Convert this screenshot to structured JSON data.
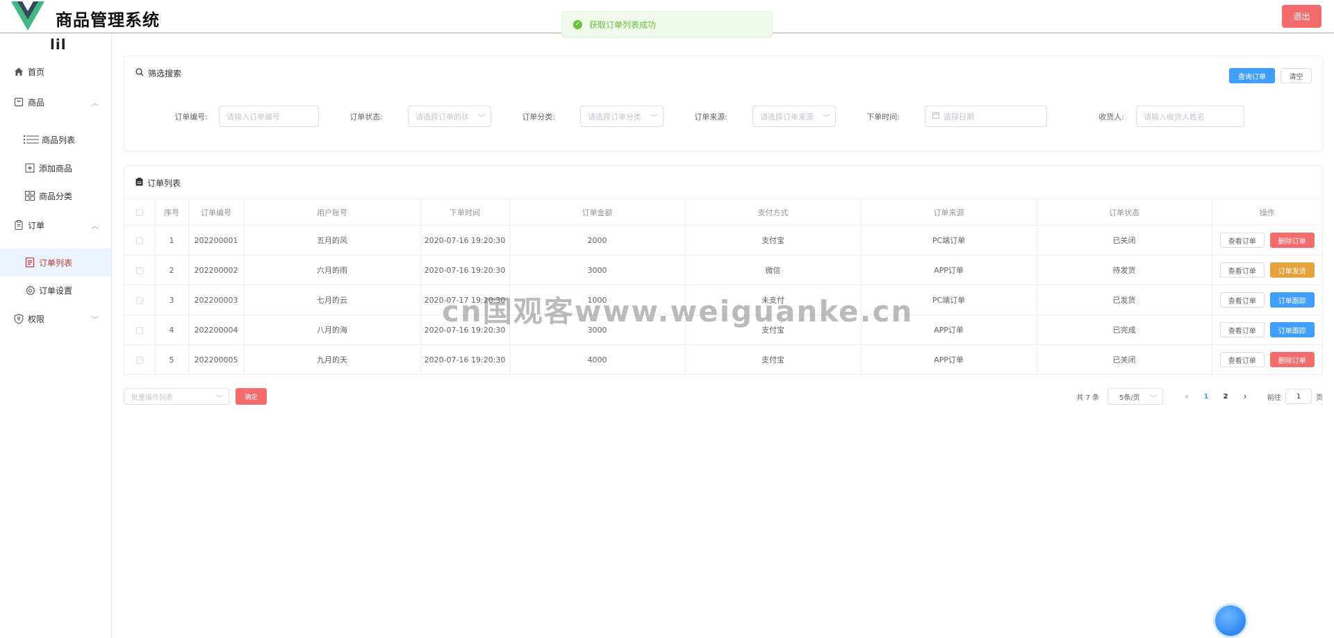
{
  "header": {
    "title": "商品管理系统",
    "logout_label": "退出"
  },
  "toast": {
    "message": "获取订单列表成功"
  },
  "sidebar": {
    "collapse_label": "lil",
    "items": [
      {
        "label": "首页",
        "icon": "home-icon"
      },
      {
        "label": "商品",
        "icon": "goods-icon",
        "expanded": true
      },
      {
        "label": "商品列表",
        "icon": "list-icon"
      },
      {
        "label": "添加商品",
        "icon": "add-box-icon"
      },
      {
        "label": "商品分类",
        "icon": "grid-icon"
      },
      {
        "label": "订单",
        "icon": "clipboard-icon",
        "expanded": true
      },
      {
        "label": "订单列表",
        "icon": "document-icon",
        "active": true
      },
      {
        "label": "订单设置",
        "icon": "gear-icon"
      },
      {
        "label": "权限",
        "icon": "shield-icon",
        "expanded": false
      }
    ]
  },
  "filter": {
    "title": "筛选搜索",
    "query_label": "查询订单",
    "clear_label": "清空",
    "fields": [
      {
        "label": "订单编号:",
        "placeholder": "请输入订单编号"
      },
      {
        "label": "订单状态:",
        "placeholder": "请选择订单的状态"
      },
      {
        "label": "订单分类:",
        "placeholder": "请选择订单分类"
      },
      {
        "label": "订单来源:",
        "placeholder": "请选择订单来源"
      },
      {
        "label": "下单时间:",
        "placeholder": "选择日期"
      },
      {
        "label": "收货人:",
        "placeholder": "请输入收货人姓名"
      }
    ]
  },
  "orders": {
    "title": "订单列表",
    "columns": [
      "序号",
      "订单编号",
      "用户账号",
      "下单时间",
      "订单金额",
      "支付方式",
      "订单来源",
      "订单状态",
      "操作"
    ],
    "rows": [
      {
        "index": "1",
        "id": "202200001",
        "user": "五月的风",
        "time": "2020-07-16 19:20:30",
        "amount": "2000",
        "pay": "支付宝",
        "source": "PC端订单",
        "status": "已关闭",
        "view": "查看订单",
        "action": "删除订单"
      },
      {
        "index": "2",
        "id": "202200002",
        "user": "六月的雨",
        "time": "2020-07-16 19:20:30",
        "amount": "3000",
        "pay": "微信",
        "source": "APP订单",
        "status": "待发货",
        "view": "查看订单",
        "action": "订单发货"
      },
      {
        "index": "3",
        "id": "202200003",
        "user": "七月的云",
        "time": "2020-07-17 19:20:30",
        "amount": "1000",
        "pay": "未支付",
        "source": "PC端订单",
        "status": "已发货",
        "view": "查看订单",
        "action": "订单跟踪"
      },
      {
        "index": "4",
        "id": "202200004",
        "user": "八月的海",
        "time": "2020-07-16 19:20:30",
        "amount": "3000",
        "pay": "支付宝",
        "source": "APP订单",
        "status": "已完成",
        "view": "查看订单",
        "action": "订单跟踪"
      },
      {
        "index": "5",
        "id": "202200005",
        "user": "九月的天",
        "time": "2020-07-16 19:20:30",
        "amount": "4000",
        "pay": "支付宝",
        "source": "APP订单",
        "status": "已关闭",
        "view": "查看订单",
        "action": "删除订单"
      }
    ]
  },
  "bottom": {
    "batch_placeholder": "批量操作列表",
    "confirm_label": "确定",
    "total": "共 7 条",
    "page_size": "5条/页",
    "pages": [
      "1",
      "2"
    ],
    "goto_prefix": "前往",
    "goto_value": "1",
    "goto_suffix": "页"
  },
  "watermark": "cn国观客www.weiguanke.cn",
  "colors": {
    "primary": "#409eff",
    "danger": "#f56c6c",
    "warning": "#e6a23c",
    "success": "#67c23a"
  }
}
